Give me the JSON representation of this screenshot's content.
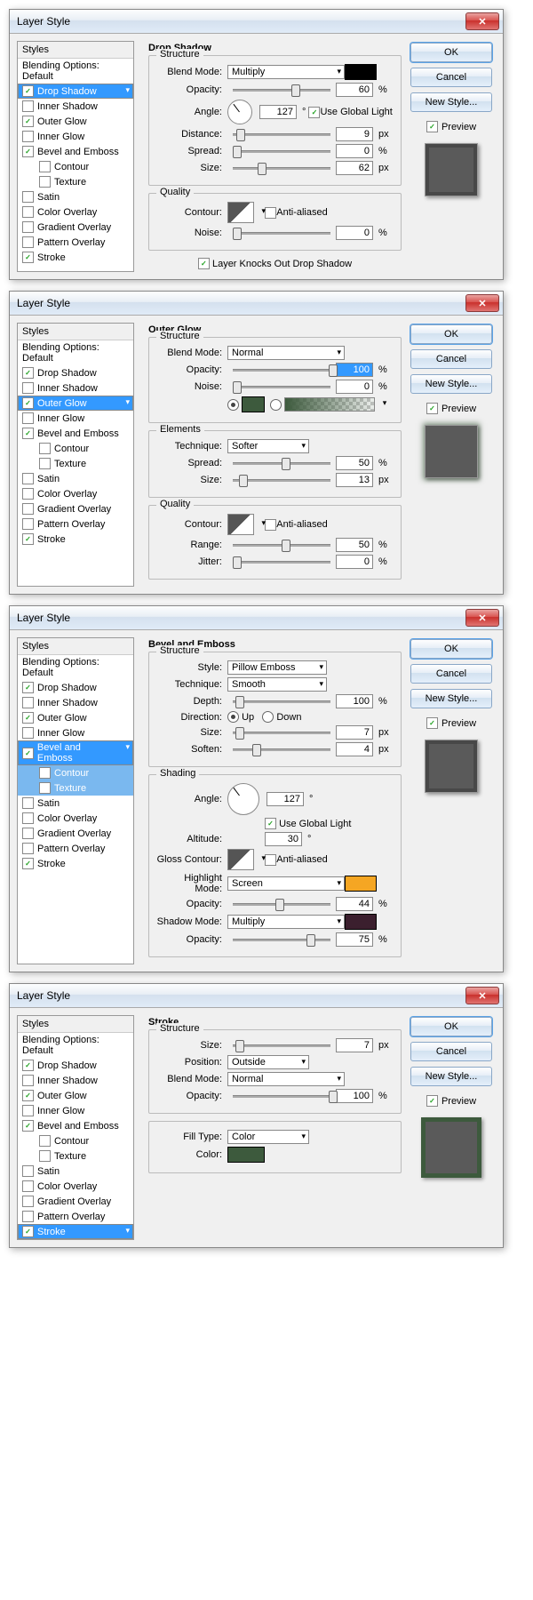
{
  "dialogs": [
    {
      "title": "Layer Style",
      "section": "Drop Shadow",
      "selected": "Drop Shadow",
      "subsel": [],
      "styles_checked": {
        "Drop Shadow": true,
        "Inner Shadow": false,
        "Outer Glow": true,
        "Inner Glow": false,
        "Bevel and Emboss": true,
        "Contour": false,
        "Texture": false,
        "Satin": false,
        "Color Overlay": false,
        "Gradient Overlay": false,
        "Pattern Overlay": false,
        "Stroke": true
      }
    },
    {
      "title": "Layer Style",
      "section": "Outer Glow",
      "selected": "Outer Glow",
      "subsel": [],
      "styles_checked": {
        "Drop Shadow": true,
        "Inner Shadow": false,
        "Outer Glow": true,
        "Inner Glow": false,
        "Bevel and Emboss": true,
        "Contour": false,
        "Texture": false,
        "Satin": false,
        "Color Overlay": false,
        "Gradient Overlay": false,
        "Pattern Overlay": false,
        "Stroke": true
      }
    },
    {
      "title": "Layer Style",
      "section": "Bevel and Emboss",
      "selected": "Bevel and Emboss",
      "subsel": [
        "Contour",
        "Texture"
      ],
      "styles_checked": {
        "Drop Shadow": true,
        "Inner Shadow": false,
        "Outer Glow": true,
        "Inner Glow": false,
        "Bevel and Emboss": true,
        "Contour": false,
        "Texture": false,
        "Satin": false,
        "Color Overlay": false,
        "Gradient Overlay": false,
        "Pattern Overlay": false,
        "Stroke": true
      }
    },
    {
      "title": "Layer Style",
      "section": "Stroke",
      "selected": "Stroke",
      "subsel": [],
      "styles_checked": {
        "Drop Shadow": true,
        "Inner Shadow": false,
        "Outer Glow": true,
        "Inner Glow": false,
        "Bevel and Emboss": true,
        "Contour": false,
        "Texture": false,
        "Satin": false,
        "Color Overlay": false,
        "Gradient Overlay": false,
        "Pattern Overlay": false,
        "Stroke": true
      }
    }
  ],
  "common": {
    "styles_header": "Styles",
    "blending": "Blending Options: Default",
    "style_list": [
      "Drop Shadow",
      "Inner Shadow",
      "Outer Glow",
      "Inner Glow",
      "Bevel and Emboss",
      "Contour",
      "Texture",
      "Satin",
      "Color Overlay",
      "Gradient Overlay",
      "Pattern Overlay",
      "Stroke"
    ],
    "indented": [
      "Contour",
      "Texture"
    ],
    "buttons": {
      "ok": "OK",
      "cancel": "Cancel",
      "newstyle": "New Style...",
      "preview": "Preview"
    }
  },
  "drop_shadow": {
    "structure": "Structure",
    "quality": "Quality",
    "blend_mode_lbl": "Blend Mode:",
    "blend_mode": "Multiply",
    "color": "#000000",
    "opacity_lbl": "Opacity:",
    "opacity": "60",
    "opacity_unit": "%",
    "angle_lbl": "Angle:",
    "angle": "127",
    "angle_unit": "°",
    "use_global": "Use Global Light",
    "use_global_ck": true,
    "distance_lbl": "Distance:",
    "distance": "9",
    "distance_unit": "px",
    "spread_lbl": "Spread:",
    "spread": "0",
    "spread_unit": "%",
    "size_lbl": "Size:",
    "size": "62",
    "size_unit": "px",
    "contour_lbl": "Contour:",
    "aa": "Anti-aliased",
    "aa_ck": false,
    "noise_lbl": "Noise:",
    "noise": "0",
    "noise_unit": "%",
    "knockout": "Layer Knocks Out Drop Shadow",
    "knockout_ck": true
  },
  "outer_glow": {
    "structure": "Structure",
    "elements": "Elements",
    "quality": "Quality",
    "blend_mode_lbl": "Blend Mode:",
    "blend_mode": "Normal",
    "opacity_lbl": "Opacity:",
    "opacity": "100",
    "opacity_unit": "%",
    "noise_lbl": "Noise:",
    "noise": "0",
    "noise_unit": "%",
    "color": "#3d5a3d",
    "technique_lbl": "Technique:",
    "technique": "Softer",
    "spread_lbl": "Spread:",
    "spread": "50",
    "spread_unit": "%",
    "size_lbl": "Size:",
    "size": "13",
    "size_unit": "px",
    "contour_lbl": "Contour:",
    "aa": "Anti-aliased",
    "aa_ck": false,
    "range_lbl": "Range:",
    "range": "50",
    "range_unit": "%",
    "jitter_lbl": "Jitter:",
    "jitter": "0",
    "jitter_unit": "%"
  },
  "bevel": {
    "structure": "Structure",
    "shading": "Shading",
    "style_lbl": "Style:",
    "style": "Pillow Emboss",
    "technique_lbl": "Technique:",
    "technique": "Smooth",
    "depth_lbl": "Depth:",
    "depth": "100",
    "depth_unit": "%",
    "direction_lbl": "Direction:",
    "up": "Up",
    "down": "Down",
    "dir_up": true,
    "size_lbl": "Size:",
    "size": "7",
    "size_unit": "px",
    "soften_lbl": "Soften:",
    "soften": "4",
    "soften_unit": "px",
    "angle_lbl": "Angle:",
    "angle": "127",
    "angle_unit": "°",
    "use_global": "Use Global Light",
    "use_global_ck": true,
    "altitude_lbl": "Altitude:",
    "altitude": "30",
    "altitude_unit": "°",
    "gloss_lbl": "Gloss Contour:",
    "aa": "Anti-aliased",
    "aa_ck": false,
    "hmode_lbl": "Highlight Mode:",
    "hmode": "Screen",
    "hcolor": "#f5a623",
    "hopacity_lbl": "Opacity:",
    "hopacity": "44",
    "hopacity_unit": "%",
    "smode_lbl": "Shadow Mode:",
    "smode": "Multiply",
    "scolor": "#3b1f2e",
    "sopacity_lbl": "Opacity:",
    "sopacity": "75",
    "sopacity_unit": "%"
  },
  "stroke": {
    "structure": "Structure",
    "size_lbl": "Size:",
    "size": "7",
    "size_unit": "px",
    "position_lbl": "Position:",
    "position": "Outside",
    "blend_mode_lbl": "Blend Mode:",
    "blend_mode": "Normal",
    "opacity_lbl": "Opacity:",
    "opacity": "100",
    "opacity_unit": "%",
    "fill_lbl": "Fill Type:",
    "fill": "Color",
    "color_lbl": "Color:",
    "color": "#3d5a3d"
  }
}
